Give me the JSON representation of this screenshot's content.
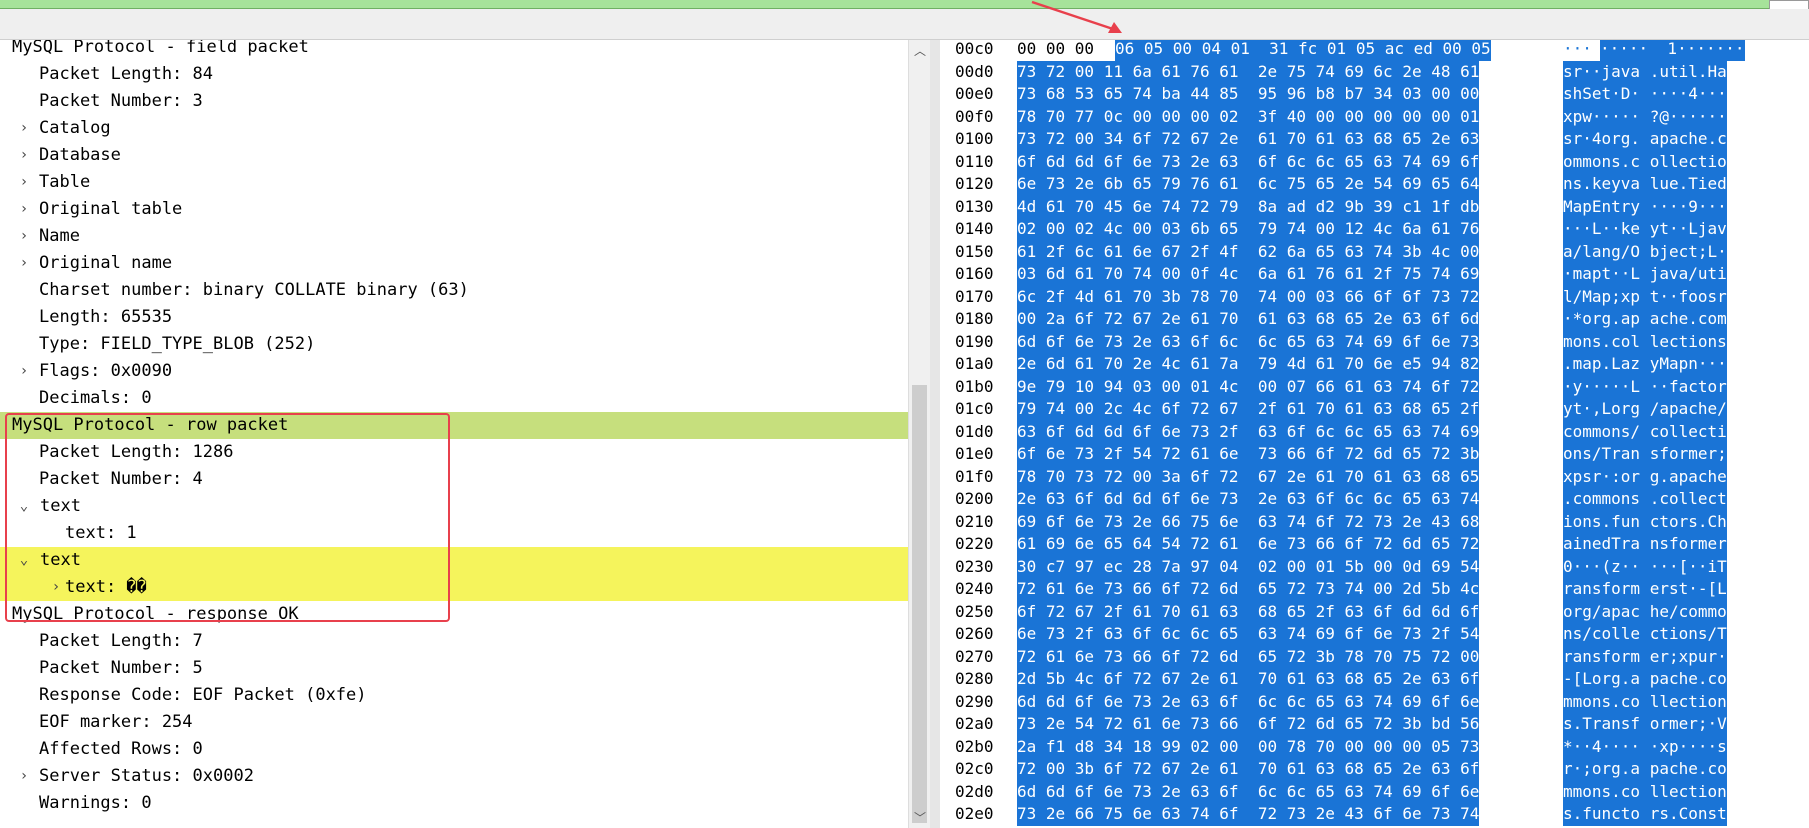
{
  "tree": {
    "rows": [
      {
        "indent": 0,
        "toggle": "",
        "text": "MySQL Protocol - field packet"
      },
      {
        "indent": 1,
        "toggle": "",
        "text": "Packet Length: 84"
      },
      {
        "indent": 1,
        "toggle": "",
        "text": "Packet Number: 3"
      },
      {
        "indent": 1,
        "toggle": "›",
        "text": "Catalog"
      },
      {
        "indent": 1,
        "toggle": "›",
        "text": "Database"
      },
      {
        "indent": 1,
        "toggle": "›",
        "text": "Table"
      },
      {
        "indent": 1,
        "toggle": "›",
        "text": "Original table"
      },
      {
        "indent": 1,
        "toggle": "›",
        "text": "Name"
      },
      {
        "indent": 1,
        "toggle": "›",
        "text": "Original name"
      },
      {
        "indent": 1,
        "toggle": "",
        "text": "Charset number: binary COLLATE binary (63)"
      },
      {
        "indent": 1,
        "toggle": "",
        "text": "Length: 65535"
      },
      {
        "indent": 1,
        "toggle": "",
        "text": "Type: FIELD_TYPE_BLOB (252)"
      },
      {
        "indent": 1,
        "toggle": "›",
        "text": "Flags: 0x0090"
      },
      {
        "indent": 1,
        "toggle": "",
        "text": "Decimals: 0"
      },
      {
        "indent": 0,
        "toggle": "",
        "text": "MySQL Protocol - row packet",
        "sel": "green"
      },
      {
        "indent": 1,
        "toggle": "",
        "text": "Packet Length: 1286"
      },
      {
        "indent": 1,
        "toggle": "",
        "text": "Packet Number: 4"
      },
      {
        "indent": 1,
        "toggle": "⌄",
        "text": "text",
        "tindent": 0
      },
      {
        "indent": 2,
        "toggle": "",
        "text": "text: 1"
      },
      {
        "indent": 1,
        "toggle": "⌄",
        "text": "text",
        "tindent": 0,
        "sel": "yellow"
      },
      {
        "indent": 2,
        "toggle": "›",
        "text": "text: ��",
        "tindent": 1,
        "sel": "yellow"
      },
      {
        "indent": 0,
        "toggle": "",
        "text": "MySQL Protocol - response OK"
      },
      {
        "indent": 1,
        "toggle": "",
        "text": "Packet Length: 7"
      },
      {
        "indent": 1,
        "toggle": "",
        "text": "Packet Number: 5"
      },
      {
        "indent": 1,
        "toggle": "",
        "text": "Response Code: EOF Packet (0xfe)"
      },
      {
        "indent": 1,
        "toggle": "",
        "text": "EOF marker: 254"
      },
      {
        "indent": 1,
        "toggle": "",
        "text": "Affected Rows: 0"
      },
      {
        "indent": 1,
        "toggle": "›",
        "text": "Server Status: 0x0002"
      },
      {
        "indent": 1,
        "toggle": "",
        "text": "Warnings: 0"
      }
    ]
  },
  "hex": {
    "rows": [
      {
        "offset": "00c0",
        "pre": "00 00 00",
        "hex": "06 05 00 04 01  31 fc 01 05 ac ed 00 05",
        "asc_pre": "···",
        "ascii": "·····  1·······"
      },
      {
        "offset": "00d0",
        "pre": "",
        "hex": "73 72 00 11 6a 61 76 61  2e 75 74 69 6c 2e 48 61",
        "asc_pre": "",
        "ascii": "sr··java .util.Ha"
      },
      {
        "offset": "00e0",
        "pre": "",
        "hex": "73 68 53 65 74 ba 44 85  95 96 b8 b7 34 03 00 00",
        "asc_pre": "",
        "ascii": "shSet·D· ····4···"
      },
      {
        "offset": "00f0",
        "pre": "",
        "hex": "78 70 77 0c 00 00 00 02  3f 40 00 00 00 00 00 01",
        "asc_pre": "",
        "ascii": "xpw····· ?@······"
      },
      {
        "offset": "0100",
        "pre": "",
        "hex": "73 72 00 34 6f 72 67 2e  61 70 61 63 68 65 2e 63",
        "asc_pre": "",
        "ascii": "sr·4org. apache.c"
      },
      {
        "offset": "0110",
        "pre": "",
        "hex": "6f 6d 6d 6f 6e 73 2e 63  6f 6c 6c 65 63 74 69 6f",
        "asc_pre": "",
        "ascii": "ommons.c ollectio"
      },
      {
        "offset": "0120",
        "pre": "",
        "hex": "6e 73 2e 6b 65 79 76 61  6c 75 65 2e 54 69 65 64",
        "asc_pre": "",
        "ascii": "ns.keyva lue.Tied"
      },
      {
        "offset": "0130",
        "pre": "",
        "hex": "4d 61 70 45 6e 74 72 79  8a ad d2 9b 39 c1 1f db",
        "asc_pre": "",
        "ascii": "MapEntry ····9···"
      },
      {
        "offset": "0140",
        "pre": "",
        "hex": "02 00 02 4c 00 03 6b 65  79 74 00 12 4c 6a 61 76",
        "asc_pre": "",
        "ascii": "···L··ke yt··Ljav"
      },
      {
        "offset": "0150",
        "pre": "",
        "hex": "61 2f 6c 61 6e 67 2f 4f  62 6a 65 63 74 3b 4c 00",
        "asc_pre": "",
        "ascii": "a/lang/O bject;L·"
      },
      {
        "offset": "0160",
        "pre": "",
        "hex": "03 6d 61 70 74 00 0f 4c  6a 61 76 61 2f 75 74 69",
        "asc_pre": "",
        "ascii": "·mapt··L java/uti"
      },
      {
        "offset": "0170",
        "pre": "",
        "hex": "6c 2f 4d 61 70 3b 78 70  74 00 03 66 6f 6f 73 72",
        "asc_pre": "",
        "ascii": "l/Map;xp t··foosr"
      },
      {
        "offset": "0180",
        "pre": "",
        "hex": "00 2a 6f 72 67 2e 61 70  61 63 68 65 2e 63 6f 6d",
        "asc_pre": "",
        "ascii": "·*org.ap ache.com"
      },
      {
        "offset": "0190",
        "pre": "",
        "hex": "6d 6f 6e 73 2e 63 6f 6c  6c 65 63 74 69 6f 6e 73",
        "asc_pre": "",
        "ascii": "mons.col lections"
      },
      {
        "offset": "01a0",
        "pre": "",
        "hex": "2e 6d 61 70 2e 4c 61 7a  79 4d 61 70 6e e5 94 82",
        "asc_pre": "",
        "ascii": ".map.Laz yMapn···"
      },
      {
        "offset": "01b0",
        "pre": "",
        "hex": "9e 79 10 94 03 00 01 4c  00 07 66 61 63 74 6f 72",
        "asc_pre": "",
        "ascii": "·y·····L ··factor"
      },
      {
        "offset": "01c0",
        "pre": "",
        "hex": "79 74 00 2c 4c 6f 72 67  2f 61 70 61 63 68 65 2f",
        "asc_pre": "",
        "ascii": "yt·,Lorg /apache/"
      },
      {
        "offset": "01d0",
        "pre": "",
        "hex": "63 6f 6d 6d 6f 6e 73 2f  63 6f 6c 6c 65 63 74 69",
        "asc_pre": "",
        "ascii": "commons/ collecti"
      },
      {
        "offset": "01e0",
        "pre": "",
        "hex": "6f 6e 73 2f 54 72 61 6e  73 66 6f 72 6d 65 72 3b",
        "asc_pre": "",
        "ascii": "ons/Tran sformer;"
      },
      {
        "offset": "01f0",
        "pre": "",
        "hex": "78 70 73 72 00 3a 6f 72  67 2e 61 70 61 63 68 65",
        "asc_pre": "",
        "ascii": "xpsr·:or g.apache"
      },
      {
        "offset": "0200",
        "pre": "",
        "hex": "2e 63 6f 6d 6d 6f 6e 73  2e 63 6f 6c 6c 65 63 74",
        "asc_pre": "",
        "ascii": ".commons .collect"
      },
      {
        "offset": "0210",
        "pre": "",
        "hex": "69 6f 6e 73 2e 66 75 6e  63 74 6f 72 73 2e 43 68",
        "asc_pre": "",
        "ascii": "ions.fun ctors.Ch"
      },
      {
        "offset": "0220",
        "pre": "",
        "hex": "61 69 6e 65 64 54 72 61  6e 73 66 6f 72 6d 65 72",
        "asc_pre": "",
        "ascii": "ainedTra nsformer"
      },
      {
        "offset": "0230",
        "pre": "",
        "hex": "30 c7 97 ec 28 7a 97 04  02 00 01 5b 00 0d 69 54",
        "asc_pre": "",
        "ascii": "0···(z·· ···[··iT"
      },
      {
        "offset": "0240",
        "pre": "",
        "hex": "72 61 6e 73 66 6f 72 6d  65 72 73 74 00 2d 5b 4c",
        "asc_pre": "",
        "ascii": "ransform erst·-[L"
      },
      {
        "offset": "0250",
        "pre": "",
        "hex": "6f 72 67 2f 61 70 61 63  68 65 2f 63 6f 6d 6d 6f",
        "asc_pre": "",
        "ascii": "org/apac he/commo"
      },
      {
        "offset": "0260",
        "pre": "",
        "hex": "6e 73 2f 63 6f 6c 6c 65  63 74 69 6f 6e 73 2f 54",
        "asc_pre": "",
        "ascii": "ns/colle ctions/T"
      },
      {
        "offset": "0270",
        "pre": "",
        "hex": "72 61 6e 73 66 6f 72 6d  65 72 3b 78 70 75 72 00",
        "asc_pre": "",
        "ascii": "ransform er;xpur·"
      },
      {
        "offset": "0280",
        "pre": "",
        "hex": "2d 5b 4c 6f 72 67 2e 61  70 61 63 68 65 2e 63 6f",
        "asc_pre": "",
        "ascii": "-[Lorg.a pache.co"
      },
      {
        "offset": "0290",
        "pre": "",
        "hex": "6d 6d 6f 6e 73 2e 63 6f  6c 6c 65 63 74 69 6f 6e",
        "asc_pre": "",
        "ascii": "mmons.co llection"
      },
      {
        "offset": "02a0",
        "pre": "",
        "hex": "73 2e 54 72 61 6e 73 66  6f 72 6d 65 72 3b bd 56",
        "asc_pre": "",
        "ascii": "s.Transf ormer;·V"
      },
      {
        "offset": "02b0",
        "pre": "",
        "hex": "2a f1 d8 34 18 99 02 00  00 78 70 00 00 00 05 73",
        "asc_pre": "",
        "ascii": "*··4···· ·xp····s"
      },
      {
        "offset": "02c0",
        "pre": "",
        "hex": "72 00 3b 6f 72 67 2e 61  70 61 63 68 65 2e 63 6f",
        "asc_pre": "",
        "ascii": "r·;org.a pache.co"
      },
      {
        "offset": "02d0",
        "pre": "",
        "hex": "6d 6d 6f 6e 73 2e 63 6f  6c 6c 65 63 74 69 6f 6e",
        "asc_pre": "",
        "ascii": "mmons.co llection"
      },
      {
        "offset": "02e0",
        "pre": "",
        "hex": "73 2e 66 75 6e 63 74 6f  72 73 2e 43 6f 6e 73 74",
        "asc_pre": "",
        "ascii": "s.functo rs.Const"
      }
    ]
  },
  "colors": {
    "selection_blue": "#1a74d6",
    "row_green": "#c6df7d",
    "row_yellow": "#f5f45c",
    "annotation_red": "#e8404c",
    "filter_green": "#a6e39a"
  }
}
